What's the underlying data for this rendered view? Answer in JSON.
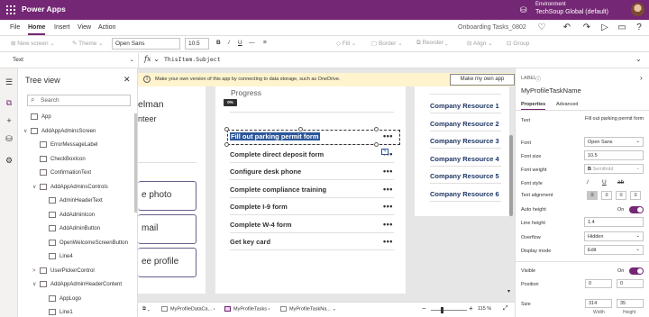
{
  "app": {
    "name": "Power Apps",
    "environment_label": "Environment",
    "environment_name": "TechSoup Global (default)"
  },
  "menu": {
    "items": [
      "File",
      "Home",
      "Insert",
      "View",
      "Action"
    ],
    "active": "Home",
    "doc_title": "Onboarding Tasks_0802"
  },
  "ribbon": {
    "new_screen": "New screen",
    "theme": "Theme",
    "font": "Open Sans",
    "font_size": "10.5",
    "bold": "B",
    "italic": "/",
    "underline": "U",
    "strike": "—",
    "fill": "Fill",
    "border": "Border",
    "reorder": "Reorder",
    "align": "Align",
    "group": "Group"
  },
  "formula_bar": {
    "property": "Text",
    "fx": "fx",
    "formula": "ThisItem.Subject"
  },
  "tree_view": {
    "title": "Tree view",
    "search_placeholder": "Search",
    "items": [
      {
        "label": "App",
        "level": 0,
        "arrow": "",
        "icon": "app-icon"
      },
      {
        "label": "AddAppAdminsScreen",
        "level": 0,
        "arrow": "∨",
        "icon": "screen-icon"
      },
      {
        "label": "ErrorMessageLabel",
        "level": 1,
        "arrow": "",
        "icon": "label-icon"
      },
      {
        "label": "CheckBoxIcon",
        "level": 1,
        "arrow": "",
        "icon": "image-icon"
      },
      {
        "label": "ConfirmationText",
        "level": 1,
        "arrow": "",
        "icon": "label-icon"
      },
      {
        "label": "AddAppAdminsControls",
        "level": 1,
        "arrow": "∨",
        "icon": "group-icon"
      },
      {
        "label": "AdminHeaderText",
        "level": 2,
        "arrow": "",
        "icon": "label-icon"
      },
      {
        "label": "AddAdminIcon",
        "level": 2,
        "arrow": "",
        "icon": "icon-icon"
      },
      {
        "label": "AddAdminButton",
        "level": 2,
        "arrow": "",
        "icon": "button-icon"
      },
      {
        "label": "OpenWelcomeScreenButton",
        "level": 2,
        "arrow": "",
        "icon": "button-icon"
      },
      {
        "label": "Line4",
        "level": 2,
        "arrow": "",
        "icon": "line-icon"
      },
      {
        "label": "UserPickerControl",
        "level": 1,
        "arrow": ">",
        "icon": "group-icon"
      },
      {
        "label": "AddAppAdminHeaderContent",
        "level": 1,
        "arrow": "∨",
        "icon": "group-icon"
      },
      {
        "label": "AppLogo",
        "level": 2,
        "arrow": "",
        "icon": "image-icon"
      },
      {
        "label": "Line1",
        "level": 2,
        "arrow": "",
        "icon": "line-icon"
      }
    ]
  },
  "banner": {
    "message": "Make your own version of this app by connecting to data storage, such as OneDrive.",
    "button": "Make my own app"
  },
  "canvas": {
    "name_line1": "elman",
    "name_line2": "nteer",
    "buttons": [
      "e photo",
      "mail",
      "ee profile"
    ],
    "progress_title": "Progress",
    "progress_badge": "0%",
    "progress_value": 0,
    "tasks": [
      "Fill out parking permit form",
      "Complete direct deposit form",
      "Configure desk phone",
      "Complete compliance training",
      "Complete I-9 form",
      "Complete W-4 form",
      "Get key card"
    ],
    "task_menu": "•••",
    "resources": [
      "Company Resource 1",
      "Company Resource 2",
      "Company Resource 3",
      "Company Resource 4",
      "Company Resource 5",
      "Company Resource 6"
    ]
  },
  "status_bar": {
    "tabs": [
      "MyProfileDataCa...",
      "MyProfileTasks",
      "MyProfileTaskNa..."
    ],
    "active_tab": "MyProfileTasks",
    "zoom": "115 %",
    "zoom_value": 115
  },
  "properties": {
    "type": "LABEL",
    "control_name": "MyProfileTaskName",
    "tabs": [
      "Properties",
      "Advanced"
    ],
    "rows": {
      "text_label": "Text",
      "text_value": "Fill out parking permit form",
      "font_label": "Font",
      "font_value": "Open Sans",
      "font_size_label": "Font size",
      "font_size_value": "10.5",
      "font_weight_label": "Font weight",
      "font_weight_value": "Semibold",
      "font_style_label": "Font style",
      "text_alignment_label": "Text alignment",
      "auto_height_label": "Auto height",
      "auto_height_value": "On",
      "line_height_label": "Line height",
      "line_height_value": "1.4",
      "overflow_label": "Overflow",
      "overflow_value": "Hidden",
      "display_mode_label": "Display mode",
      "display_mode_value": "Edit",
      "visible_label": "Visible",
      "visible_value": "On",
      "position_label": "Position",
      "position_x": "0",
      "position_y": "0",
      "size_label": "Size",
      "size_width": "314",
      "size_height": "35",
      "width_caption": "Width",
      "height_caption": "Height"
    }
  },
  "colors": {
    "brand": "#742774",
    "selection": "#2b579a",
    "resource_text": "#1f3864",
    "banner_bg": "#fff4ce"
  }
}
